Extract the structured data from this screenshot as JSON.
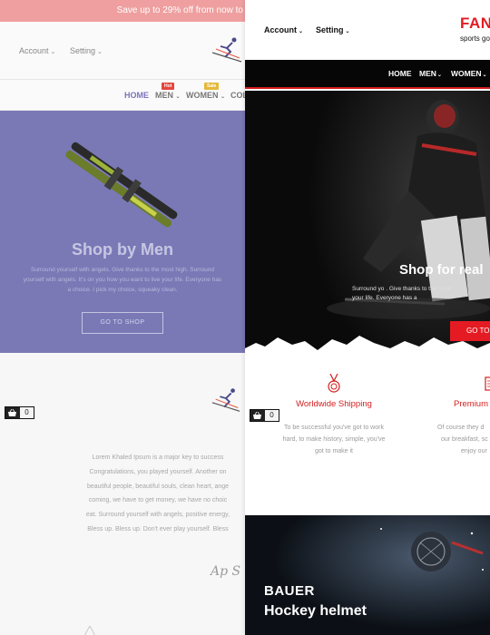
{
  "back_theme": {
    "promo_text": "Save up to 29% off from now to",
    "account_label": "Account",
    "setting_label": "Setting",
    "menu": {
      "home": "HOME",
      "men": "MEN",
      "women": "WOMEN",
      "partial": "COL",
      "badge_men": "Hot",
      "badge_women": "Sale"
    },
    "hero": {
      "title": "Shop by Men",
      "desc_lines": [
        "Surround yourself with angels. Give thanks to the most high. Surround",
        "yourself with angels. It's on you how you want to live your life. Everyone has",
        "a choice. I pick my choice, squeaky clean."
      ],
      "button": "GO TO SHOP"
    },
    "lorem_lines": [
      "Lorem Khaled Ipsum is a major key to success",
      "Congratulations, you played yourself. Another on",
      "beautiful people, beautiful souls, clean heart, ange",
      "coming, we have to get money, we have no choic",
      "eat. Surround yourself with angels, positive energy,",
      "Bless up. Bless up. Don't ever play yourself. Bless"
    ],
    "signature": "Ap S",
    "cart_count": "0"
  },
  "front_theme": {
    "account_label": "Account",
    "setting_label": "Setting",
    "brand": "FAN",
    "brand_sub": "sports go",
    "nav": {
      "home": "HOME",
      "men": "MEN",
      "women": "WOMEN"
    },
    "hero": {
      "title": "Shop for real",
      "desc_lines": [
        "Surround yo       . Give thanks to the most",
        "                          your life. Everyone has a"
      ],
      "button": "GO TO"
    },
    "features": [
      {
        "icon": "medal-icon",
        "title": "Worldwide Shipping",
        "desc_lines": [
          "To be successful you've got to work",
          "hard, to make history, simple, you've",
          "got to make it"
        ]
      },
      {
        "icon": "ticket-icon",
        "title": "Premium",
        "desc_lines": [
          "Of course they d",
          "our breakfast, sc",
          "enjoy our"
        ]
      }
    ],
    "banner": {
      "brand": "BAUER",
      "product": "Hockey helmet"
    },
    "cart_count": "0"
  },
  "colors": {
    "promo_bg": "#ef9f9f",
    "back_hero_bg": "#7a79b6",
    "accent_red": "#e41b23",
    "nav_black": "#060606"
  }
}
